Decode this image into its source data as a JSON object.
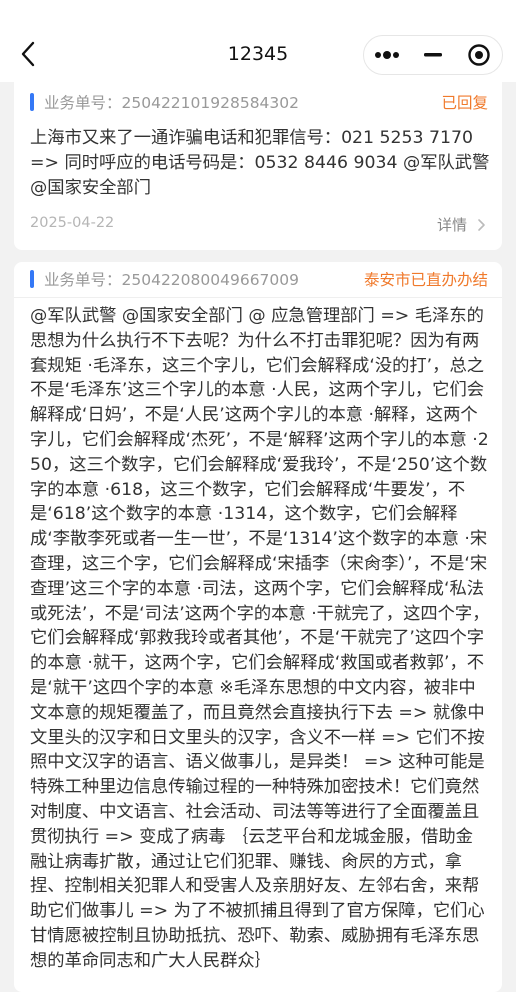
{
  "nav": {
    "title": "12345",
    "back_icon": "chevron-left-icon",
    "more_icon": "more-dots-icon",
    "minimize_icon": "minimize-icon",
    "close_icon": "target-close-icon"
  },
  "tickets": [
    {
      "order_label": "业务单号：250422101928584302",
      "status": "已回复",
      "content": "上海市又来了一通诈骗电话和犯罪信号：021 5253 7170 => 同时呼应的电话号码是：0532 8446 9034 @军队武警 @国家安全部门",
      "date": "2025-04-22",
      "detail_label": "详情"
    },
    {
      "order_label": "业务单号：250422080049667009",
      "status": "泰安市已直办办结",
      "content": "@军队武警 @国家安全部门 @ 应急管理部门 => 毛泽东的思想为什么执行不下去呢？为什么不打击罪犯呢？因为有两套规矩 ·毛泽东，这三个字儿，它们会解释成‘没的打’，总之不是‘毛泽东’这三个字儿的本意 ·人民，这两个字儿，它们会解释成‘日妈’，不是‘人民’这两个字儿的本意 ·解释，这两个字儿，它们会解释成‘杰死’，不是‘解释’这两个字儿的本意 ·250，这三个数字，它们会解释成‘爱我玲’，不是‘250’这个数字的本意 ·618，这三个数字，它们会解释成‘牛要发’，不是‘618’这个数字的本意 ·1314，这个数字，它们会解释成‘李散李死或者一生一世’，不是‘1314’这个数字的本意 ·宋查理，这三个字，它们会解释成‘宋插李（宋肏李）’，不是‘宋查理’这三个字的本意 ·司法，这两个字，它们会解释成‘私法或死法’，不是‘司法’这两个字的本意 ·干就完了，这四个字，它们会解释成‘郭救我玲或者其他’，不是‘干就完了’这四个字的本意 ·就干，这两个字，它们会解释成‘救国或者救郭’，不是‘就干’这四个字的本意 ※毛泽东思想的中文内容，被非中文本意的规矩覆盖了，而且竟然会直接执行下去 => 就像中文里头的汉字和日文里头的汉字，含义不一样 => 它们不按照中文汉字的语言、语义做事儿，是异类！ => 这种可能是特殊工种里边信息传输过程的一种特殊加密技术！它们竟然对制度、中文语言、社会活动、司法等等进行了全面覆盖且贯彻执行 => 变成了病毒 ｛云芝平台和龙城金服，借助金融让病毒扩散，通过让它们犯罪、赚钱、肏屄的方式，拿捏、控制相关犯罪人和受害人及亲朋好友、左邻右舍，来帮助它们做事儿 => 为了不被抓捕且得到了官方保障，它们心甘情愿被控制且协助抵抗、恐吓、勒索、威胁拥有毛泽东思想的革命同志和广大人民群众｝"
    }
  ],
  "colors": {
    "accent": "#3478f6",
    "status": "#f07a2c",
    "background": "#f2f2f2"
  }
}
